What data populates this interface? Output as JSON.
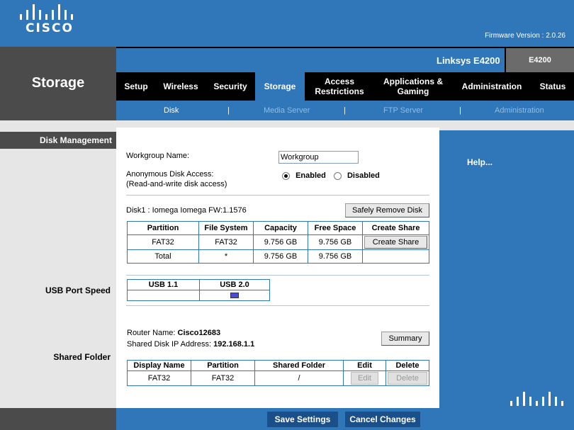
{
  "brand": {
    "logo_text": "CISCO"
  },
  "firmware": "Firmware Version : 2.0.26",
  "section_title": "Storage",
  "product_name": "Linksys E4200",
  "model": "E4200",
  "main_tabs": [
    {
      "label": "Setup"
    },
    {
      "label": "Wireless"
    },
    {
      "label": "Security"
    },
    {
      "label": "Storage"
    },
    {
      "label": "Access Restrictions"
    },
    {
      "label": "Applications & Gaming"
    },
    {
      "label": "Administration"
    },
    {
      "label": "Status"
    }
  ],
  "sub_tabs": [
    {
      "label": "Disk"
    },
    {
      "label": "Media Server"
    },
    {
      "label": "FTP Server"
    },
    {
      "label": "Administration"
    }
  ],
  "separator": "|",
  "left_sections": {
    "disk_management": "Disk Management",
    "usb_port_speed": "USB Port Speed",
    "shared_folder": "Shared Folder"
  },
  "workgroup": {
    "label": "Workgroup Name:",
    "value": "Workgroup"
  },
  "anonymous": {
    "label": "Anonymous Disk Access:",
    "sublabel": "(Read-and-write disk access)",
    "enabled_label": "Enabled",
    "disabled_label": "Disabled",
    "selected": "Enabled"
  },
  "disk": {
    "title": "Disk1 : Iomega Iomega FW:1.1576",
    "remove_button": "Safely Remove Disk",
    "headers": [
      "Partition",
      "File System",
      "Capacity",
      "Free Space",
      "Create Share"
    ],
    "rows": [
      {
        "partition": "FAT32",
        "fs": "FAT32",
        "capacity": "9.756 GB",
        "free": "9.756 GB",
        "action": "Create Share"
      },
      {
        "partition": "Total",
        "fs": "*",
        "capacity": "9.756 GB",
        "free": "9.756 GB",
        "action": ""
      }
    ]
  },
  "usb": {
    "headers": [
      "USB 1.1",
      "USB 2.0"
    ],
    "selected": "USB 2.0"
  },
  "router": {
    "name_label": "Router Name:",
    "name_value": "Cisco12683",
    "ip_label": "Shared Disk IP Address:",
    "ip_value": "192.168.1.1",
    "summary_button": "Summary"
  },
  "shares": {
    "headers": [
      "Display Name",
      "Partition",
      "Shared Folder",
      "Edit",
      "Delete"
    ],
    "rows": [
      {
        "display": "FAT32",
        "partition": "FAT32",
        "folder": "/",
        "edit": "Edit",
        "delete": "Delete"
      }
    ]
  },
  "help_link": "Help...",
  "footer": {
    "save": "Save Settings",
    "cancel": "Cancel Changes"
  },
  "colors": {
    "brand_blue": "#2f77b8",
    "dark_gray": "#4b4b4b"
  }
}
